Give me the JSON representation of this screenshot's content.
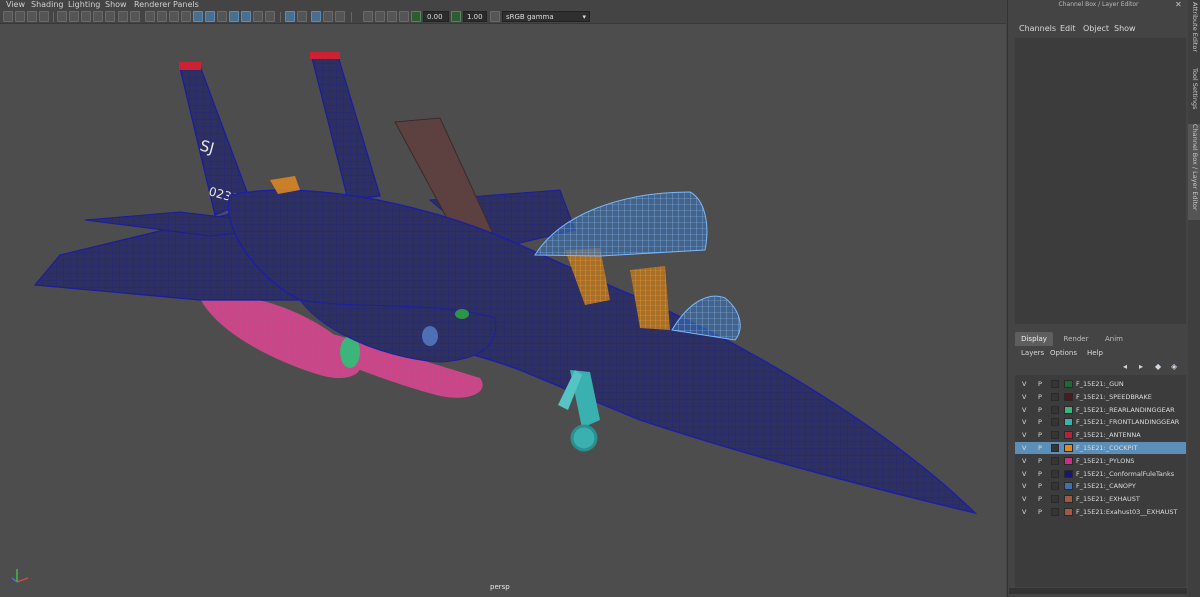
{
  "menu": [
    "View",
    "Shading",
    "Lighting",
    "Show",
    "Renderer",
    "Panels"
  ],
  "toolbar": {
    "value_a": "0.00",
    "value_b": "1.00",
    "colorspace": "sRGB gamma"
  },
  "viewport": {
    "camera_label": "persp",
    "aircraft_tail_code": "SJ",
    "aircraft_serial": "0230"
  },
  "channel_box": {
    "title": "Channel Box / Layer Editor",
    "menu": [
      "Channels",
      "Edit",
      "Object",
      "Show"
    ]
  },
  "layer_editor": {
    "tabs": [
      "Display",
      "Render",
      "Anim"
    ],
    "active_tab": "Display",
    "menu": [
      "Layers",
      "Options",
      "Help"
    ],
    "layers": [
      {
        "v": "V",
        "p": "P",
        "name": "F_15E21:_GUN",
        "color": "#1e6a35"
      },
      {
        "v": "V",
        "p": "P",
        "name": "F_15E21:_SPEEDBRAKE",
        "color": "#4a1b1b"
      },
      {
        "v": "V",
        "p": "P",
        "name": "F_15E21:_REARLANDINGGEAR",
        "color": "#3bb57a"
      },
      {
        "v": "V",
        "p": "P",
        "name": "F_15E21:_FRONTLANDINGGEAR",
        "color": "#3bb0b0"
      },
      {
        "v": "V",
        "p": "P",
        "name": "F_15E21:_ANTENNA",
        "color": "#b4223a"
      },
      {
        "v": "V",
        "p": "P",
        "name": "F_15E21:_COCKPIT",
        "color": "#e08a22",
        "selected": true
      },
      {
        "v": "V",
        "p": "P",
        "name": "F_15E21:_PYLONS",
        "color": "#cc2f86"
      },
      {
        "v": "V",
        "p": "P",
        "name": "F_15E21:_ConformalFuleTanks",
        "color": "#1a1570"
      },
      {
        "v": "V",
        "p": "P",
        "name": "F_15E21:_CANOPY",
        "color": "#3e6fae"
      },
      {
        "v": "V",
        "p": "P",
        "name": "F_15E21:_EXHAUST",
        "color": "#a05a43"
      },
      {
        "v": "V",
        "p": "P",
        "name": "F_15E21:Exahust03__EXHAUST",
        "color": "#a05a43"
      }
    ]
  },
  "side_tabs": [
    "Attribute Editor",
    "Tool Settings",
    "Channel Box / Layer Editor"
  ]
}
